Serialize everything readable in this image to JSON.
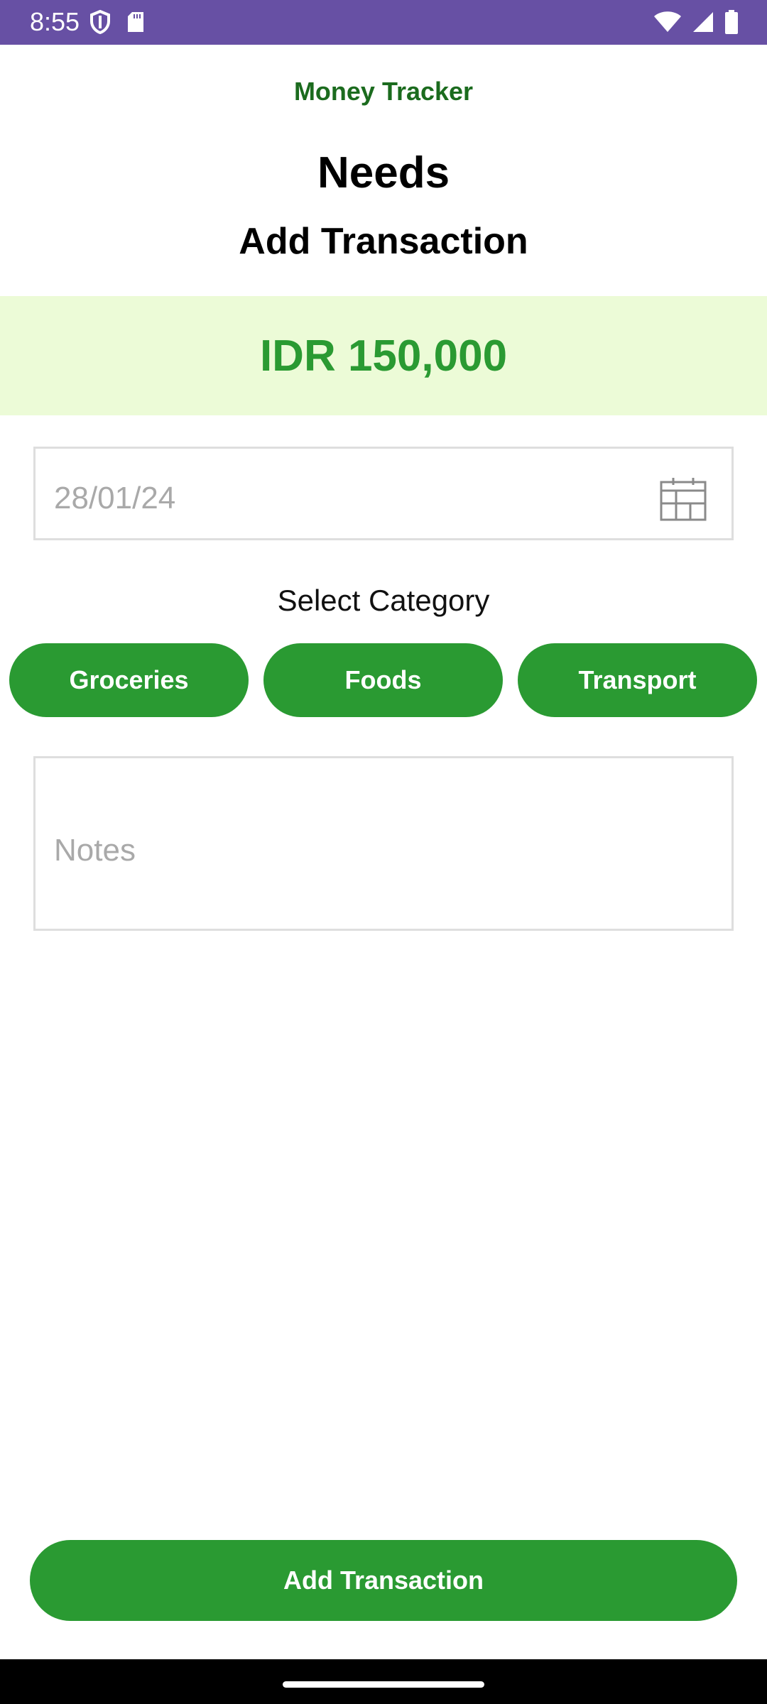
{
  "status_bar": {
    "time": "8:55",
    "left_icons": [
      "shield-icon",
      "sd-card-icon"
    ],
    "right_icons": [
      "wifi-icon",
      "signal-icon",
      "battery-icon"
    ],
    "background": "#6750a4"
  },
  "header": {
    "app_title": "Money Tracker",
    "section_title": "Needs",
    "page_title": "Add Transaction"
  },
  "amount": {
    "text": "IDR 150,000",
    "color": "#2a9a32",
    "background": "#ecfbd7"
  },
  "date_field": {
    "value": "28/01/24",
    "icon": "calendar-icon"
  },
  "category": {
    "label": "Select Category",
    "options": [
      "Groceries",
      "Foods",
      "Transport"
    ]
  },
  "notes": {
    "placeholder": "Notes"
  },
  "submit": {
    "label": "Add Transaction"
  },
  "colors": {
    "accent": "#2a9a32",
    "title_green": "#1b6b1e"
  }
}
